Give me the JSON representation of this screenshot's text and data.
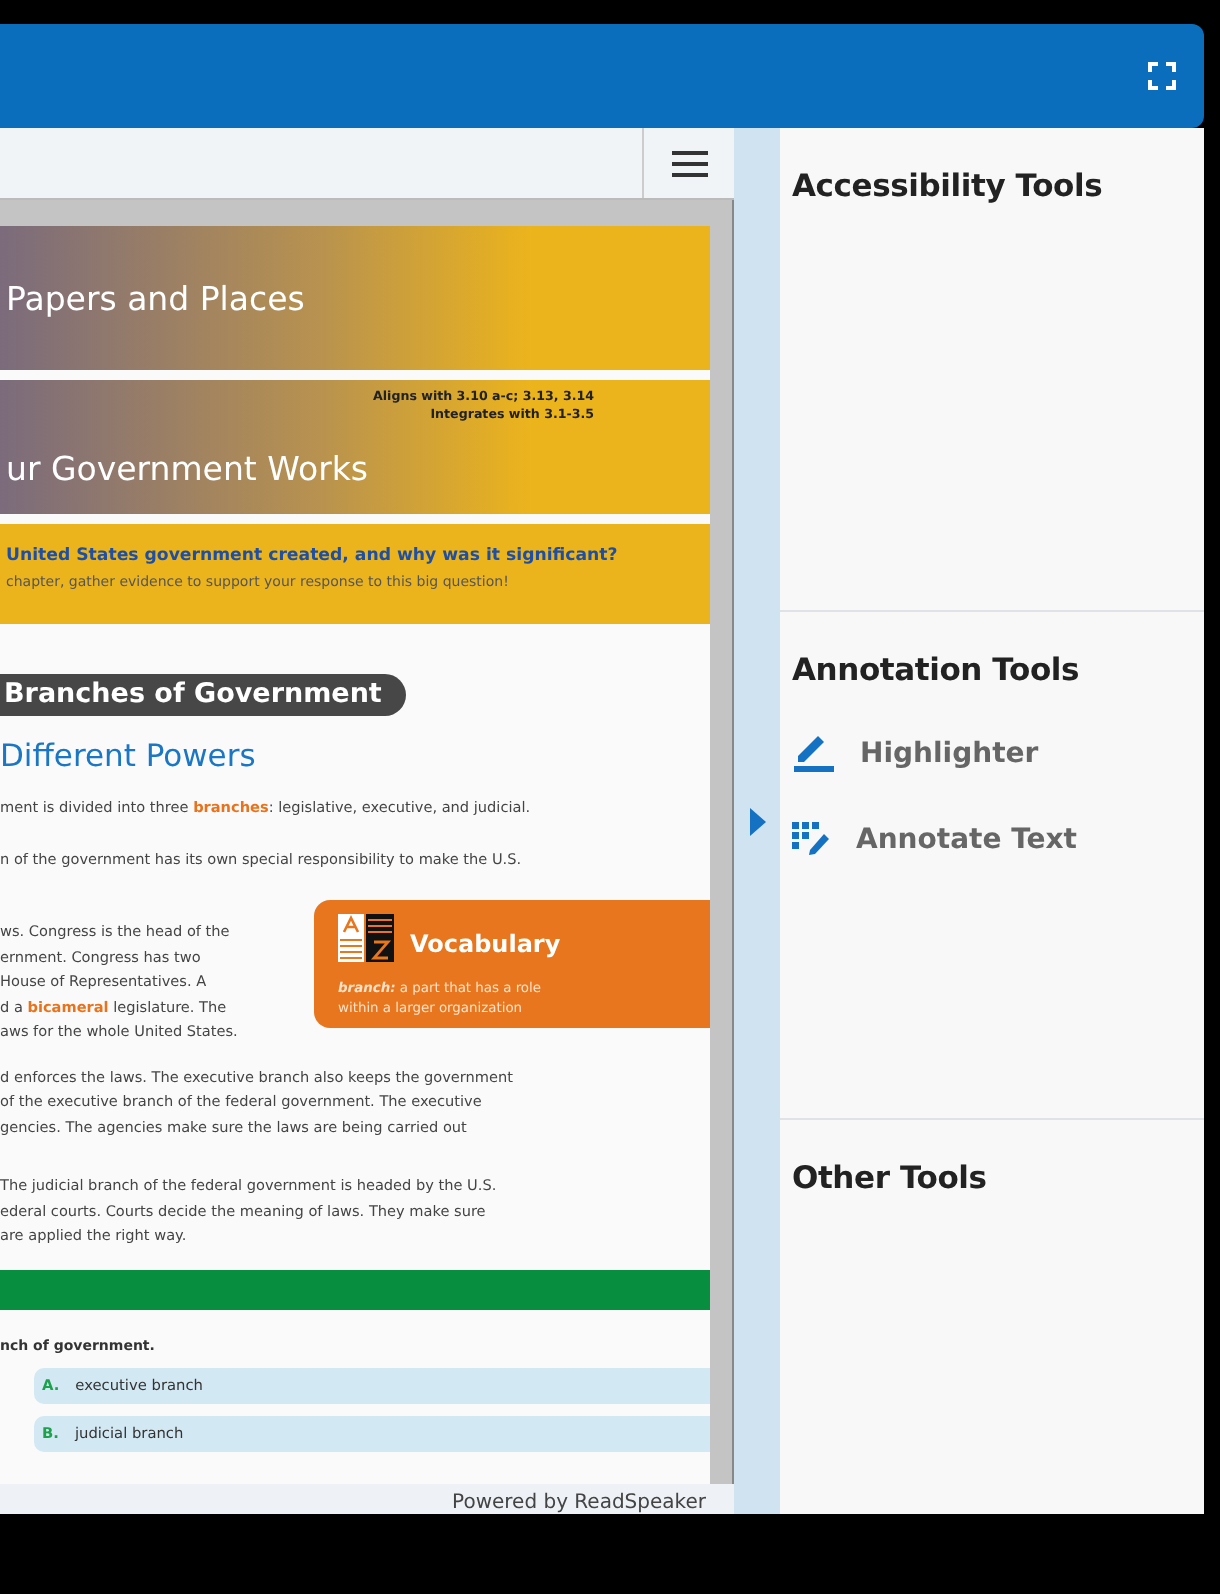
{
  "document": {
    "banners": [
      {
        "title": "Papers and Places"
      },
      {
        "title": "ur Government Works",
        "standards": [
          "Aligns with 3.10 a-c; 3.13, 3.14",
          "Integrates with 3.1-3.5"
        ]
      }
    ],
    "big_question": {
      "question": "United States government created, and why was it significant?",
      "instruction": "chapter, gather evidence to support your response to this big question!"
    },
    "section_label": "Branches of Government",
    "heading": "Different Powers",
    "intro": [
      [
        "ment is divided into three **branches**:  legislative, executive, and judicial."
      ],
      [
        "n of the government has its own special responsibility to make the U.S."
      ]
    ],
    "side_paragraph": [
      "ws.  Congress is the head of the",
      "ernment.  Congress has two",
      " House of Representatives.  A",
      "d a **bicameral**  legislature.  The",
      "aws for the whole United States."
    ],
    "vocabulary": {
      "title": "Vocabulary",
      "term": "branch:",
      "definition": "a part that has a role within a larger organization"
    },
    "paragraphs": [
      [
        "d enforces the laws.  The executive branch also keeps the government",
        "of the executive branch of the federal government.  The executive",
        "gencies.  The agencies make sure the laws are being carried out"
      ],
      [
        " The judicial branch of the federal government is headed by the U.S.",
        "ederal courts.  Courts decide the meaning of laws.  They make sure",
        "are applied the right way."
      ]
    ],
    "question": "nch of government.",
    "choices": [
      {
        "letter": "A.",
        "text": "executive branch"
      },
      {
        "letter": "B.",
        "text": "judicial branch"
      }
    ]
  },
  "footer": "Powered by ReadSpeaker",
  "tool_sections": [
    {
      "title": "Accessibility Tools"
    },
    {
      "title": "Annotation Tools",
      "tools": [
        {
          "kind": "highlighter",
          "label": "Highlighter"
        },
        {
          "kind": "annotate",
          "label": "Annotate Text"
        }
      ]
    },
    {
      "title": "Other Tools"
    }
  ]
}
